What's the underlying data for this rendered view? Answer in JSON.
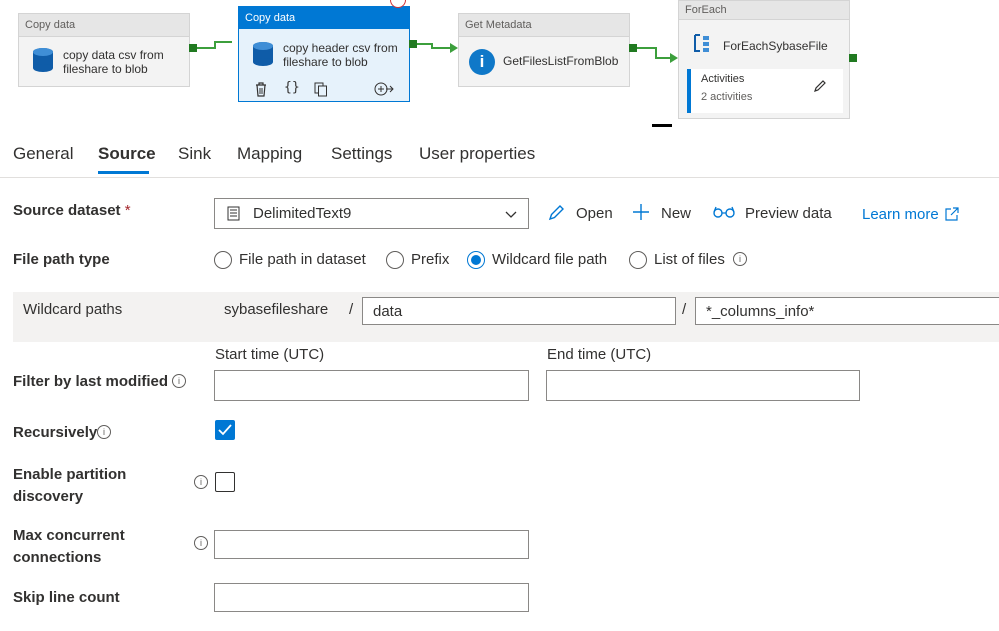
{
  "pipeline": {
    "nodes": [
      {
        "type": "Copy data",
        "name": "copy data csv from fileshare to blob"
      },
      {
        "type": "Copy data",
        "name": "copy header csv from fileshare to blob"
      },
      {
        "type": "Get Metadata",
        "name": "GetFilesListFromBlob"
      },
      {
        "type": "ForEach",
        "name": "ForEachSybaseFile",
        "activities_label": "Activities",
        "activities_count": "2 activities"
      }
    ]
  },
  "tabs": [
    "General",
    "Source",
    "Sink",
    "Mapping",
    "Settings",
    "User properties"
  ],
  "active_tab": "Source",
  "form": {
    "source_dataset": {
      "label": "Source dataset",
      "required": "*",
      "value": "DelimitedText9"
    },
    "actions": {
      "open": "Open",
      "new": "New",
      "preview": "Preview data",
      "learn_more": "Learn more"
    },
    "file_path_type": {
      "label": "File path type",
      "options": [
        "File path in dataset",
        "Prefix",
        "Wildcard file path",
        "List of files"
      ],
      "selected": "Wildcard file path"
    },
    "wildcard": {
      "label": "Wildcard paths",
      "container": "sybasefileshare",
      "sep": "/",
      "folder": "data",
      "file": "*_columns_info*"
    },
    "filter": {
      "label": "Filter by last modified",
      "start_label": "Start time (UTC)",
      "end_label": "End time (UTC)",
      "start_value": "",
      "end_value": ""
    },
    "recursively": {
      "label": "Recursively",
      "checked": true
    },
    "partition": {
      "label_line1": "Enable partition",
      "label_line2": "discovery",
      "checked": false
    },
    "max_conn": {
      "label_line1": "Max concurrent",
      "label_line2": "connections",
      "value": ""
    },
    "skip": {
      "label": "Skip line count",
      "value": ""
    }
  },
  "colors": {
    "accent": "#0078d4",
    "success": "#3c9f3c"
  }
}
